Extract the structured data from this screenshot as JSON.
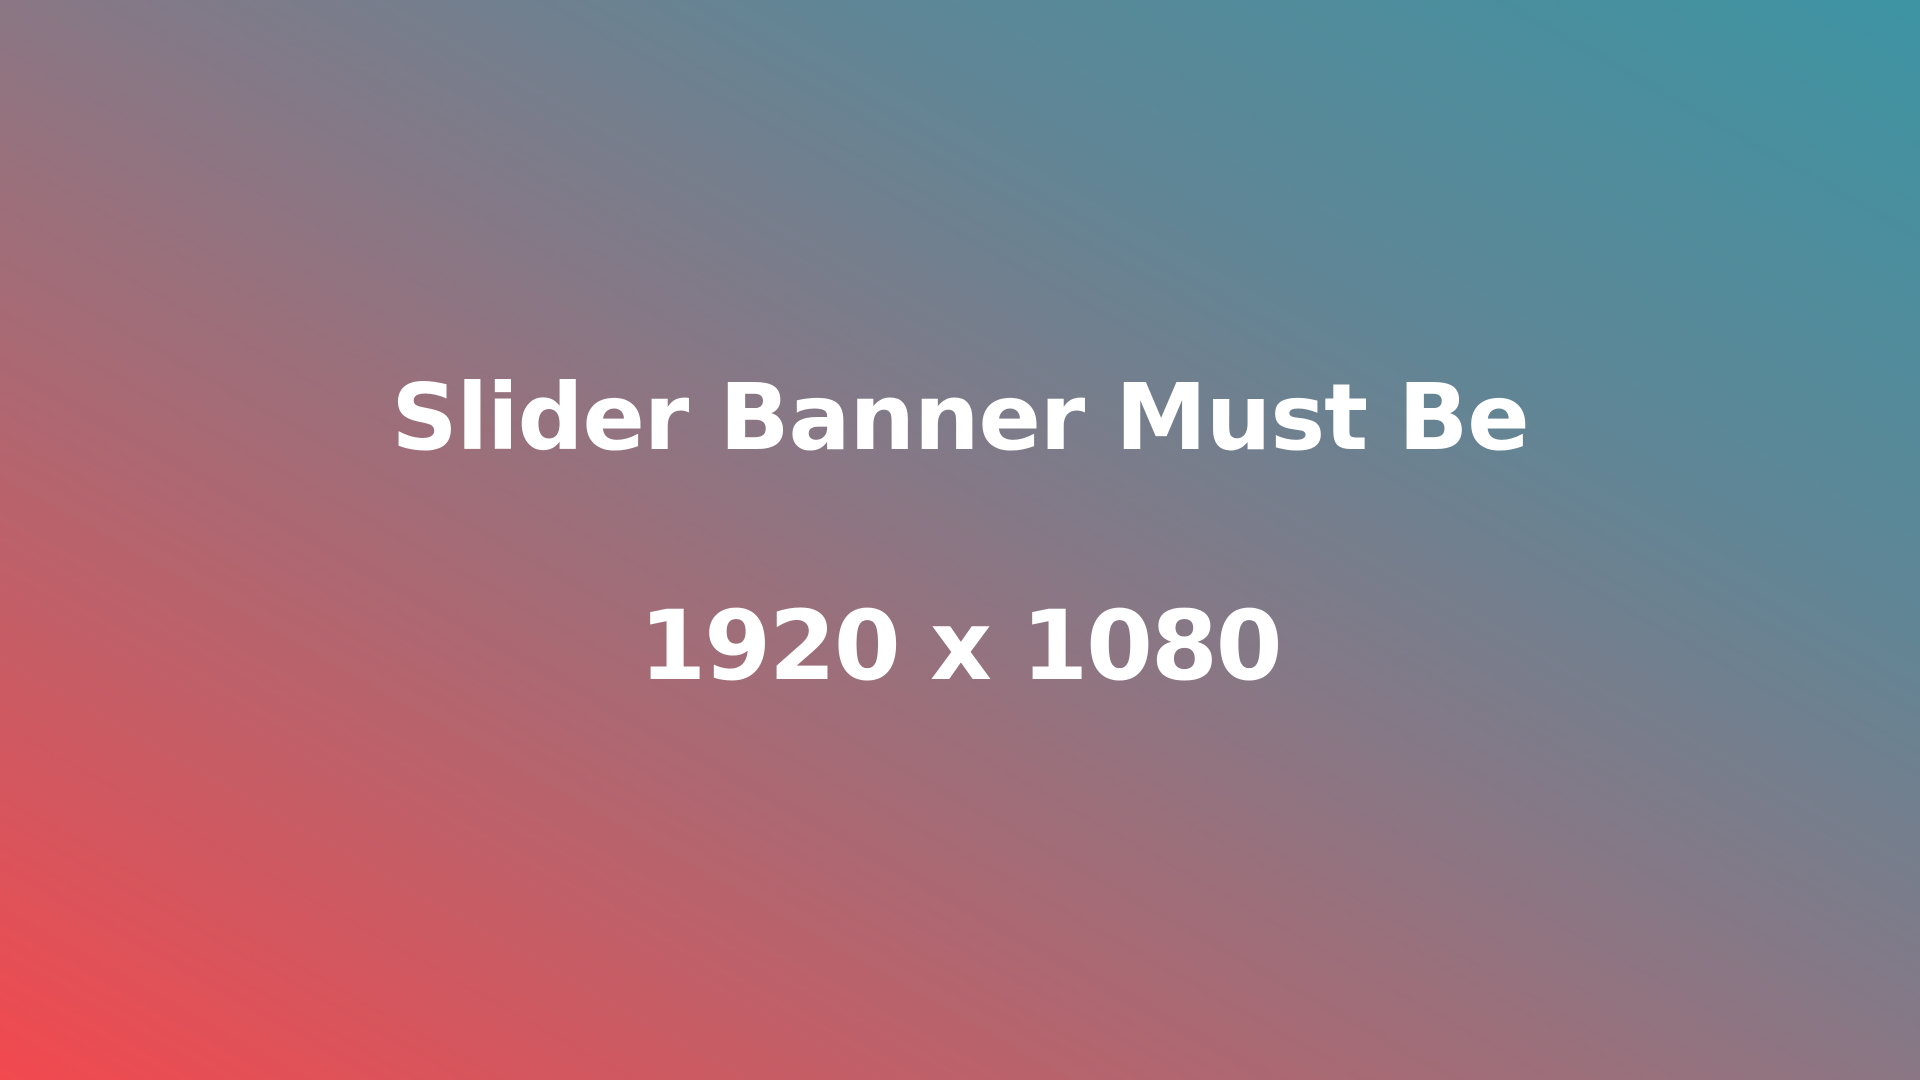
{
  "banner": {
    "headline": "Slider Banner Must Be",
    "dimensions": "1920 x 1080"
  },
  "colors": {
    "gradient_bottom_left": "#f2494f",
    "gradient_middle": "#867886",
    "gradient_top_right": "#3d94a3",
    "text": "#ffffff"
  }
}
